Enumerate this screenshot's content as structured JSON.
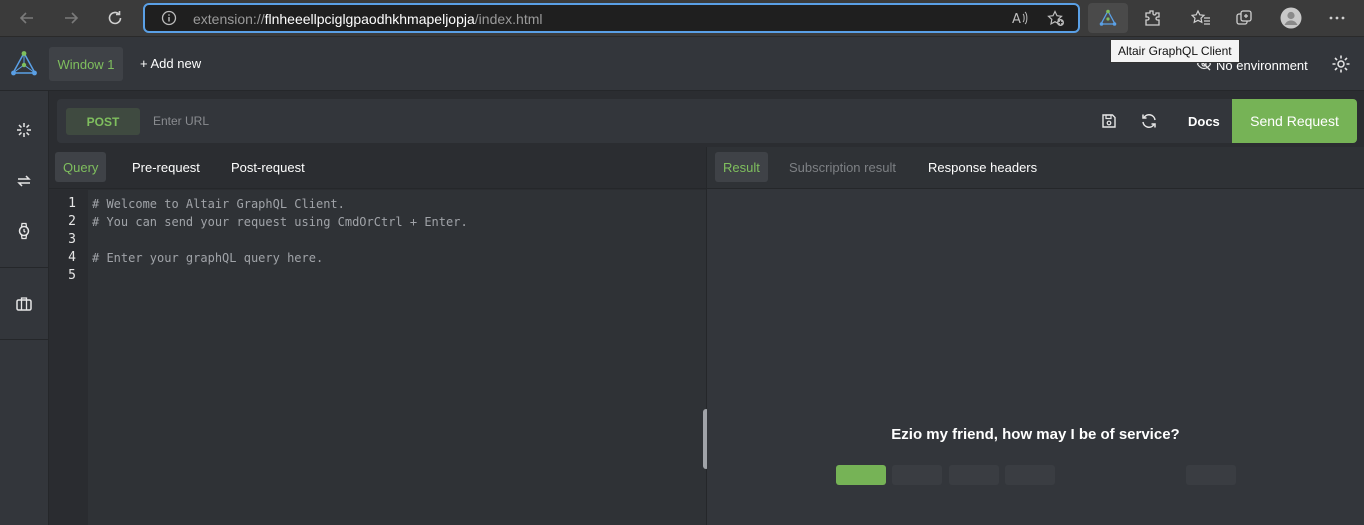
{
  "browser": {
    "url_prefix": "extension://",
    "url_host": "flnheeellpciglgpaodhkhmapeljopja",
    "url_path": "/index.html",
    "tooltip": "Altair GraphQL Client"
  },
  "header": {
    "window_tab": "Window 1",
    "add_new": "+ Add new",
    "environment": "No environment"
  },
  "request": {
    "method": "POST",
    "url_placeholder": "Enter URL",
    "docs_label": "Docs",
    "send_label": "Send Request"
  },
  "query_tabs": [
    "Query",
    "Pre-request",
    "Post-request"
  ],
  "editor": {
    "lines": [
      {
        "no": "1",
        "text": "# Welcome to Altair GraphQL Client."
      },
      {
        "no": "2",
        "text": "# You can send your request using CmdOrCtrl + Enter."
      },
      {
        "no": "3",
        "text": ""
      },
      {
        "no": "4",
        "text": "# Enter your graphQL query here."
      },
      {
        "no": "5",
        "text": ""
      }
    ]
  },
  "result_tabs": [
    "Result",
    "Subscription result",
    "Response headers"
  ],
  "result": {
    "greeting": "Ezio my friend, how may I be of service?"
  },
  "colors": {
    "accent": "#76b356",
    "address_border": "#5aa0e6"
  }
}
